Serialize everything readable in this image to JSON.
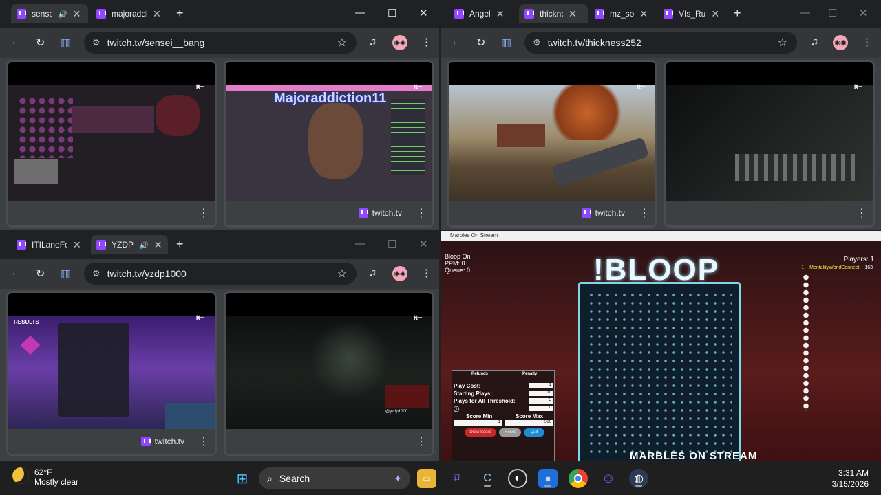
{
  "windows": {
    "top_left": {
      "tabs": [
        {
          "label": "sensei__bang",
          "active": true,
          "muted": true
        },
        {
          "label": "majoraddiction11",
          "active": false
        }
      ],
      "url": "twitch.tv/sensei__bang",
      "pips": [
        {
          "label": "",
          "overlay": ""
        },
        {
          "label": "twitch.tv",
          "overlay": "Majoraddiction11"
        }
      ]
    },
    "top_right": {
      "tabs": [
        {
          "label": "Angel",
          "active": false
        },
        {
          "label": "thickness252",
          "active": true
        },
        {
          "label": "mz_so",
          "active": false
        },
        {
          "label": "VIs_Ru",
          "active": false
        }
      ],
      "url": "twitch.tv/thickness252",
      "pips": [
        {
          "label": "twitch.tv"
        },
        {
          "label": ""
        }
      ]
    },
    "bottom_left": {
      "tabs": [
        {
          "label": "ITILaneFo",
          "active": false
        },
        {
          "label": "YZDP",
          "active": true,
          "muted": true
        }
      ],
      "url": "twitch.tv/yzdp1000",
      "pips": [
        {
          "label": "twitch.tv",
          "overlay": "RESULTS"
        },
        {
          "label": "",
          "overlay": "@yzdp1000"
        }
      ]
    }
  },
  "game": {
    "window_title": "Marbles On Stream",
    "title": "!BLOOP",
    "stats": [
      "Bloop On",
      "PPM: 0",
      "Queue: 0"
    ],
    "players_label": "Players: 1",
    "player_rank": "1",
    "player_name": "MentalityWorldConnect",
    "player_score": "163",
    "logo": "MARBLES ON STREAM",
    "panel": {
      "refunds": "Refunds",
      "penalty": "Penalty",
      "play_cost_label": "Play Cost:",
      "play_cost": "1",
      "starting_plays_label": "Starting Plays:",
      "starting_plays": "10",
      "threshold_label": "Plays for All Threshold:",
      "threshold": "5",
      "extra_value": "0",
      "score_min_label": "Score Min",
      "score_min": "1",
      "score_max_label": "Score Max",
      "score_max": "500",
      "btn_draw": "Draw Score",
      "btn_reset": "Reset",
      "btn_quit": "Quit"
    }
  },
  "taskbar": {
    "weather_temp": "62°F",
    "weather_desc": "Mostly clear",
    "search_placeholder": "Search",
    "time": "3:31 AM",
    "date": "3/15/2026"
  },
  "colors": {
    "twitch": "#9146ff",
    "chrome_dark": "#202124",
    "chrome_toolbar": "#35363a"
  }
}
